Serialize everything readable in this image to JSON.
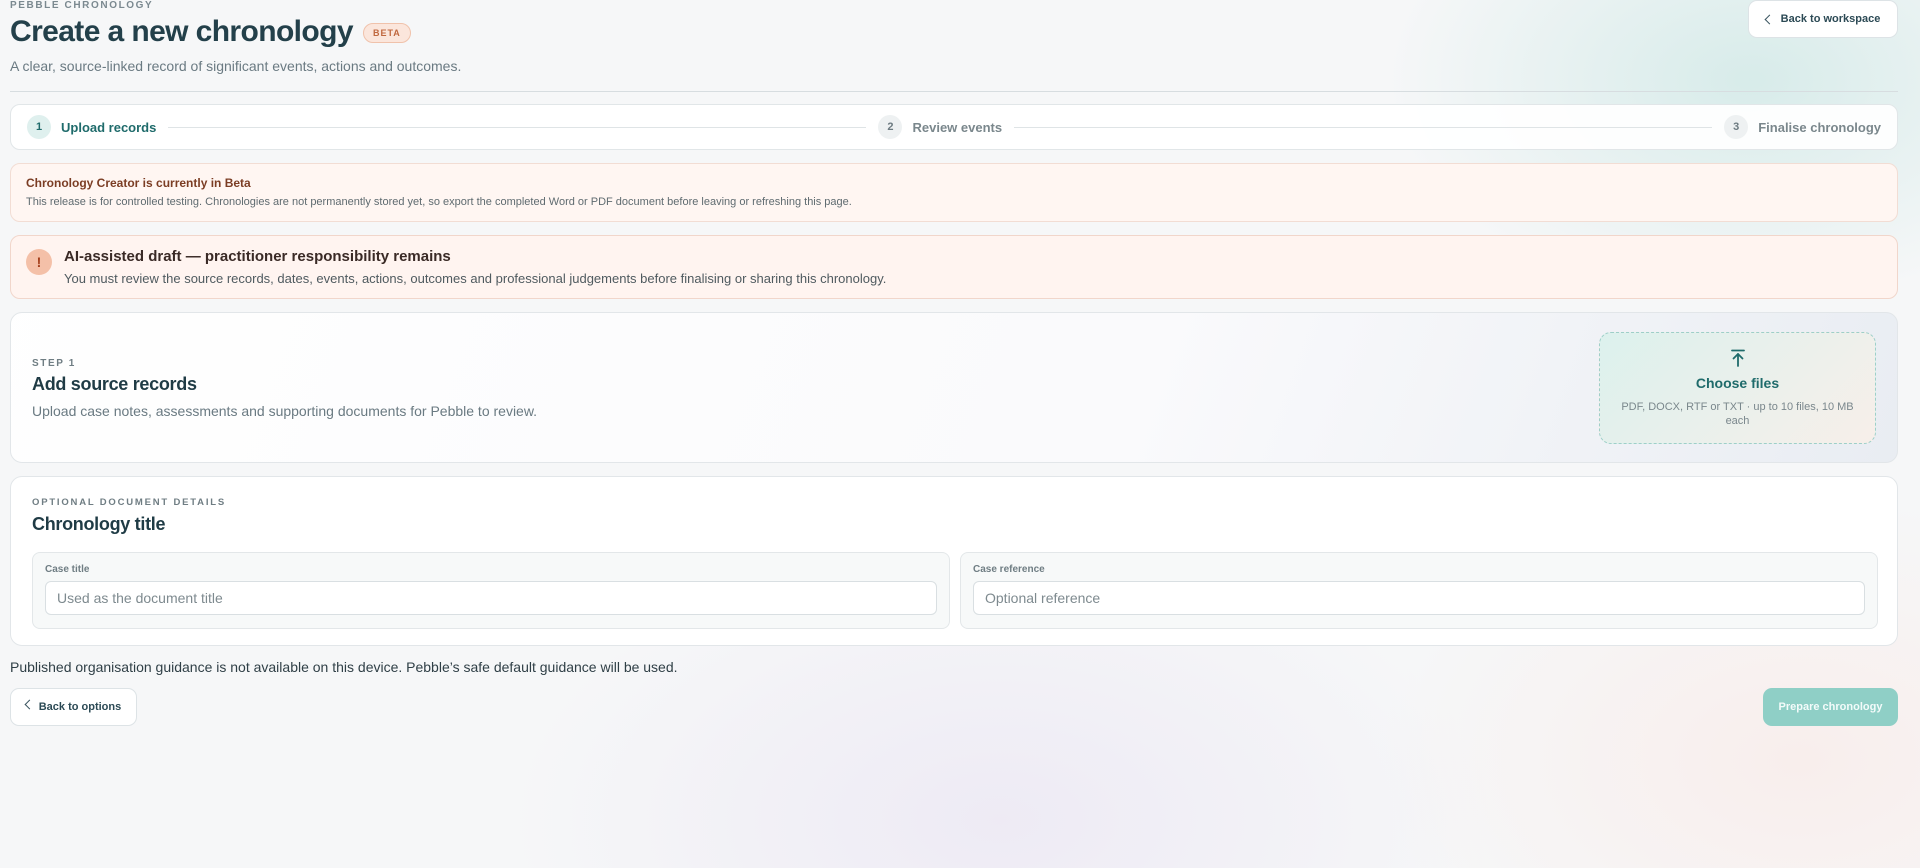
{
  "header": {
    "eyebrow": "PEBBLE CHRONOLOGY",
    "title": "Create a new chronology",
    "badge": "BETA",
    "subtitle": "A clear, source-linked record of significant events, actions and outcomes.",
    "back_label": "Back to workspace"
  },
  "stepper": {
    "steps": [
      {
        "number": "1",
        "label": "Upload records",
        "state": "active"
      },
      {
        "number": "2",
        "label": "Review events",
        "state": "inactive"
      },
      {
        "number": "3",
        "label": "Finalise chronology",
        "state": "inactive"
      }
    ]
  },
  "beta_notice": {
    "title": "Chronology Creator is currently in Beta",
    "text": "This release is for controlled testing. Chronologies are not permanently stored yet, so export the completed Word or PDF document before leaving or refreshing this page."
  },
  "ai_notice": {
    "icon": "!",
    "title": "AI-assisted draft — practitioner responsibility remains",
    "text": "You must review the source records, dates, events, actions, outcomes and professional judgements before finalising or sharing this chronology."
  },
  "upload": {
    "eyebrow": "STEP 1",
    "title": "Add source records",
    "text": "Upload case notes, assessments and supporting documents for Pebble to review.",
    "choose_label": "Choose files",
    "hint": "PDF, DOCX, RTF or TXT · up to 10 files, 10 MB each"
  },
  "details": {
    "eyebrow": "OPTIONAL DOCUMENT DETAILS",
    "title": "Chronology title",
    "case_title": {
      "label": "Case title",
      "value": "",
      "placeholder": "Used as the document title"
    },
    "case_reference": {
      "label": "Case reference",
      "value": "",
      "placeholder": "Optional reference"
    }
  },
  "guidance_note": "Published organisation guidance is not available on this device. Pebble’s safe default guidance will be used.",
  "footer": {
    "back_label": "Back to options",
    "prepare_label": "Prepare chronology"
  },
  "colors": {
    "accent": "#1f6b6b",
    "primary_button_disabled": "#8fcfc6",
    "beta_badge": "#c0683f",
    "warning_bg": "#fff4f0"
  },
  "icons": {
    "back_workspace": "chevron-left-icon",
    "warning": "exclamation-icon",
    "upload": "upload-arrow-icon",
    "back_options": "chevron-left-icon"
  }
}
